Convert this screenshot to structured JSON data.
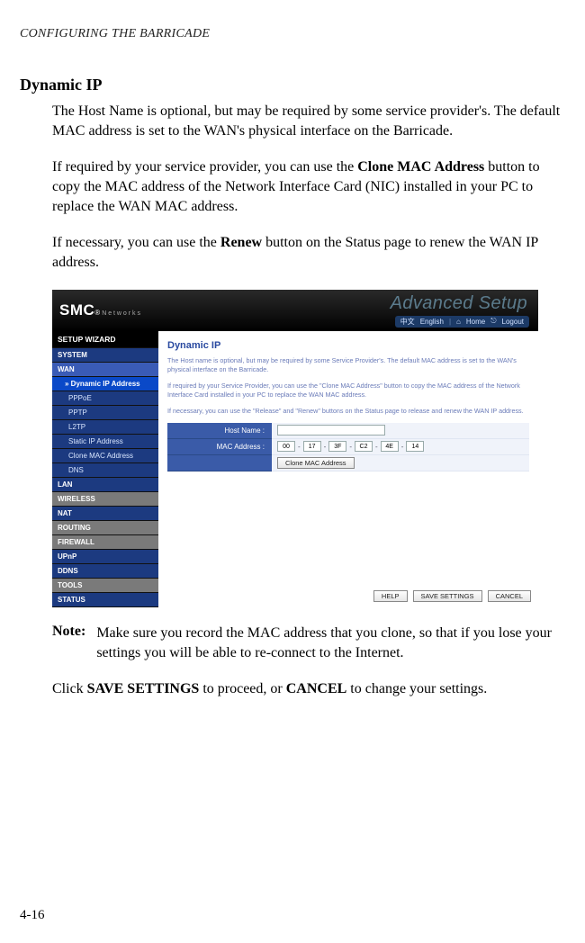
{
  "running_head": "CONFIGURING THE BARRICADE",
  "section_title": "Dynamic IP",
  "paragraphs": {
    "p1": "The Host Name is optional, but may be required by some service provider's. The default MAC address is set to the WAN's physical interface on the Barricade.",
    "p2_a": "If required by your service provider, you can use the ",
    "p2_bold": "Clone MAC Address",
    "p2_b": " button to copy the MAC address of the Network Interface Card (NIC) installed in your PC to replace the WAN MAC address.",
    "p3_a": "If necessary, you can use the ",
    "p3_bold": "Renew",
    "p3_b": " button on the Status page to renew the WAN IP address."
  },
  "note": {
    "label": "Note:",
    "text": "Make sure you record the MAC address that you clone, so that if you lose your settings you will be able to re-connect to the Internet."
  },
  "closing": {
    "a": "Click ",
    "b1": "SAVE SETTINGS",
    "c": " to proceed, or ",
    "b2": "CANCEL",
    "d": " to change your settings."
  },
  "page_number": "4-16",
  "screenshot": {
    "logo": {
      "main": "SMC",
      "reg": "®",
      "sub": "N e t w o r k s"
    },
    "adv_setup": "Advanced Setup",
    "topbar": {
      "lang1": "中文",
      "lang2": "English",
      "home": "Home",
      "logout": "Logout"
    },
    "menu": {
      "setup": "SETUP WIZARD",
      "system": "SYSTEM",
      "wan": "WAN",
      "dynip": "Dynamic IP Address",
      "pppoe": "PPPoE",
      "pptp": "PPTP",
      "l2tp": "L2TP",
      "staticip": "Static IP Address",
      "clonemac": "Clone MAC Address",
      "dns": "DNS",
      "lan": "LAN",
      "wireless": "WIRELESS",
      "nat": "NAT",
      "routing": "ROUTING",
      "firewall": "FIREWALL",
      "upnp": "UPnP",
      "ddns": "DDNS",
      "tools": "TOOLS",
      "status": "STATUS"
    },
    "panel": {
      "title": "Dynamic IP",
      "p1": "The Host name is optional, but may be required by some Service Provider's. The default MAC address is set to the WAN's physical interface on the Barricade.",
      "p2": "If required by your Service Provider, you can use the \"Clone MAC Address\" button to copy the MAC address of the Network Interface Card installed in your PC to replace the WAN MAC address.",
      "p3": "If necessary, you can use the \"Release\" and \"Renew\" buttons on the Status page to release and renew the WAN IP address.",
      "host_label": "Host Name :",
      "mac_label": "MAC Address :",
      "mac": [
        "00",
        "17",
        "3F",
        "C2",
        "4E",
        "14"
      ],
      "clone_btn": "Clone MAC Address",
      "help": "HELP",
      "save": "SAVE SETTINGS",
      "cancel": "CANCEL"
    }
  }
}
